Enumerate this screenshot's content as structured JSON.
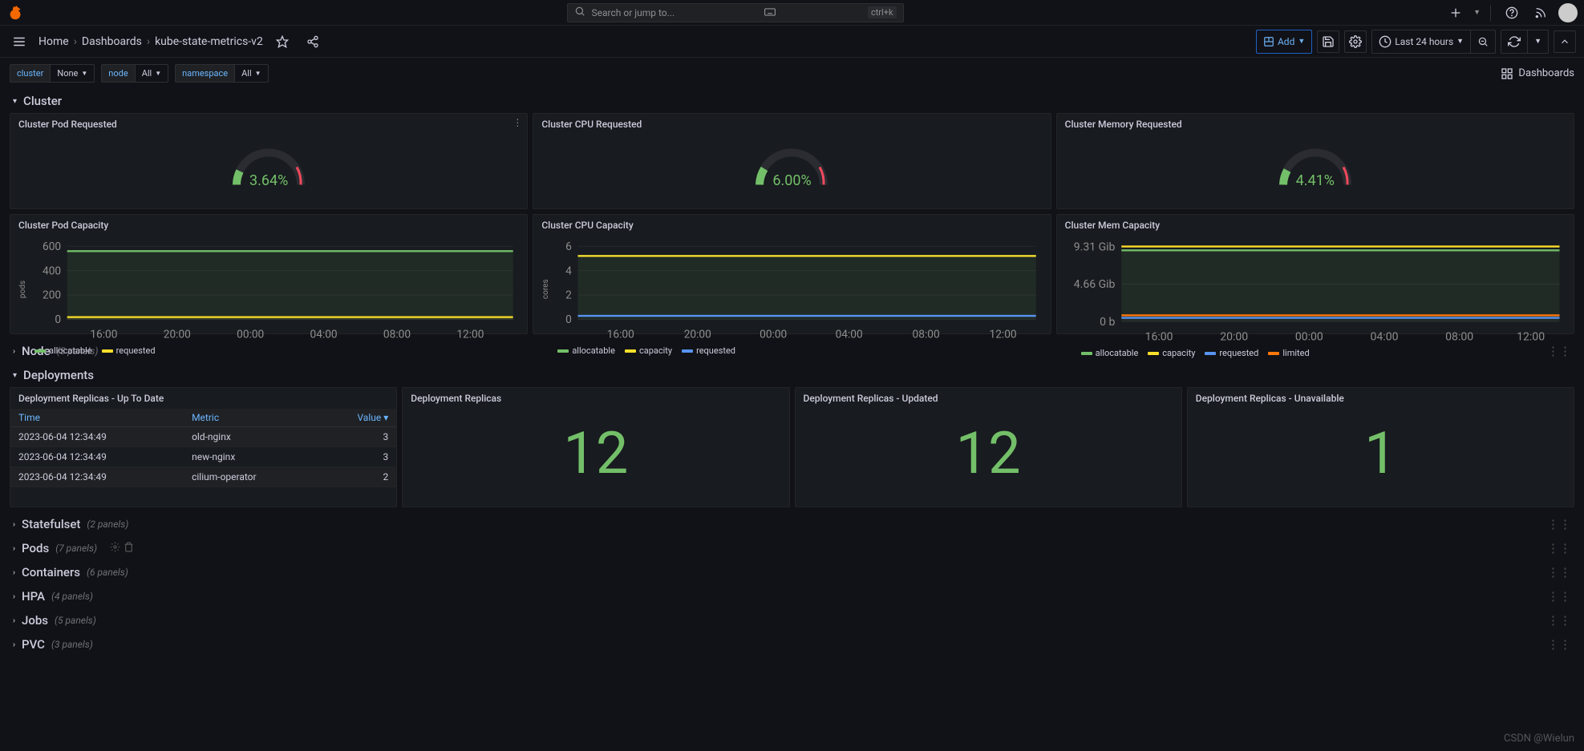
{
  "search": {
    "placeholder": "Search or jump to...",
    "shortcut": "ctrl+k"
  },
  "breadcrumb": {
    "home": "Home",
    "dashboards": "Dashboards",
    "current": "kube-state-metrics-v2"
  },
  "toolbar": {
    "add": "Add",
    "time_range": "Last 24 hours"
  },
  "vars": {
    "cluster_label": "cluster",
    "cluster_value": "None",
    "node_label": "node",
    "node_value": "All",
    "namespace_label": "namespace",
    "namespace_value": "All",
    "dashboards_link": "Dashboards"
  },
  "rows": {
    "cluster": {
      "title": "Cluster"
    },
    "node": {
      "title": "Node",
      "count": "(5 panels)"
    },
    "deployments": {
      "title": "Deployments"
    },
    "statefulset": {
      "title": "Statefulset",
      "count": "(2 panels)"
    },
    "pods": {
      "title": "Pods",
      "count": "(7 panels)"
    },
    "containers": {
      "title": "Containers",
      "count": "(6 panels)"
    },
    "hpa": {
      "title": "HPA",
      "count": "(4 panels)"
    },
    "jobs": {
      "title": "Jobs",
      "count": "(5 panels)"
    },
    "pvc": {
      "title": "PVC",
      "count": "(3 panels)"
    }
  },
  "gauges": {
    "pod_requested": {
      "title": "Cluster Pod Requested",
      "value": "3.64%"
    },
    "cpu_requested": {
      "title": "Cluster CPU Requested",
      "value": "6.00%"
    },
    "mem_requested": {
      "title": "Cluster Memory Requested",
      "value": "4.41%"
    }
  },
  "capacity_panels": {
    "pod": {
      "title": "Cluster Pod Capacity",
      "ylabel": "pods",
      "legend": [
        "allocatable",
        "requested"
      ]
    },
    "cpu": {
      "title": "Cluster CPU Capacity",
      "ylabel": "cores",
      "legend": [
        "allocatable",
        "capacity",
        "requested"
      ]
    },
    "mem": {
      "title": "Cluster Mem Capacity",
      "ylabel": "",
      "legend": [
        "allocatable",
        "capacity",
        "requested",
        "limited"
      ]
    }
  },
  "deployments_table": {
    "title": "Deployment Replicas - Up To Date",
    "headers": {
      "time": "Time",
      "metric": "Metric",
      "value": "Value"
    },
    "rows": [
      {
        "time": "2023-06-04 12:34:49",
        "metric": "old-nginx",
        "value": "3"
      },
      {
        "time": "2023-06-04 12:34:49",
        "metric": "new-nginx",
        "value": "3"
      },
      {
        "time": "2023-06-04 12:34:49",
        "metric": "cilium-operator",
        "value": "2"
      }
    ]
  },
  "deployment_stats": {
    "replicas": {
      "title": "Deployment Replicas",
      "value": "12"
    },
    "updated": {
      "title": "Deployment Replicas - Updated",
      "value": "12"
    },
    "unavailable": {
      "title": "Deployment Replicas - Unavailable",
      "value": "1"
    }
  },
  "watermark": "CSDN @Wielun",
  "chart_data": [
    {
      "type": "line",
      "title": "Cluster Pod Capacity",
      "ylabel": "pods",
      "x": [
        "16:00",
        "20:00",
        "00:00",
        "04:00",
        "08:00",
        "12:00"
      ],
      "ylim": [
        0,
        600
      ],
      "yticks": [
        0,
        200,
        400,
        600
      ],
      "colors": {
        "allocatable": "#73bf69",
        "requested": "#fade2a"
      },
      "series": [
        {
          "name": "allocatable",
          "values": [
            550,
            550,
            550,
            550,
            550,
            550
          ]
        },
        {
          "name": "requested",
          "values": [
            20,
            20,
            20,
            20,
            20,
            20
          ]
        }
      ]
    },
    {
      "type": "line",
      "title": "Cluster CPU Capacity",
      "ylabel": "cores",
      "x": [
        "16:00",
        "20:00",
        "00:00",
        "04:00",
        "08:00",
        "12:00"
      ],
      "ylim": [
        0,
        6
      ],
      "yticks": [
        0,
        2,
        4,
        6
      ],
      "colors": {
        "allocatable": "#73bf69",
        "capacity": "#fade2a",
        "requested": "#5794f2"
      },
      "series": [
        {
          "name": "allocatable",
          "values": [
            5,
            5,
            5,
            5,
            5,
            5
          ]
        },
        {
          "name": "capacity",
          "values": [
            5,
            5,
            5,
            5,
            5,
            5
          ]
        },
        {
          "name": "requested",
          "values": [
            0.3,
            0.3,
            0.3,
            0.3,
            0.3,
            0.3
          ]
        }
      ]
    },
    {
      "type": "line",
      "title": "Cluster Mem Capacity",
      "ylabel": "",
      "x": [
        "16:00",
        "20:00",
        "00:00",
        "04:00",
        "08:00",
        "12:00"
      ],
      "yticks_labels": [
        "0 b",
        "4.66 Gib",
        "9.31 Gib"
      ],
      "ylim": [
        0,
        10
      ],
      "colors": {
        "allocatable": "#73bf69",
        "capacity": "#fade2a",
        "requested": "#5794f2",
        "limited": "#ff780a"
      },
      "series": [
        {
          "name": "allocatable",
          "values": [
            8.8,
            8.8,
            8.8,
            8.8,
            8.8,
            8.8
          ]
        },
        {
          "name": "capacity",
          "values": [
            9.3,
            9.3,
            9.3,
            9.3,
            9.3,
            9.3
          ]
        },
        {
          "name": "requested",
          "values": [
            0.44,
            0.44,
            0.44,
            0.44,
            0.44,
            0.44
          ]
        },
        {
          "name": "limited",
          "values": [
            0.77,
            0.77,
            0.77,
            0.77,
            0.77,
            0.77
          ]
        }
      ]
    }
  ]
}
